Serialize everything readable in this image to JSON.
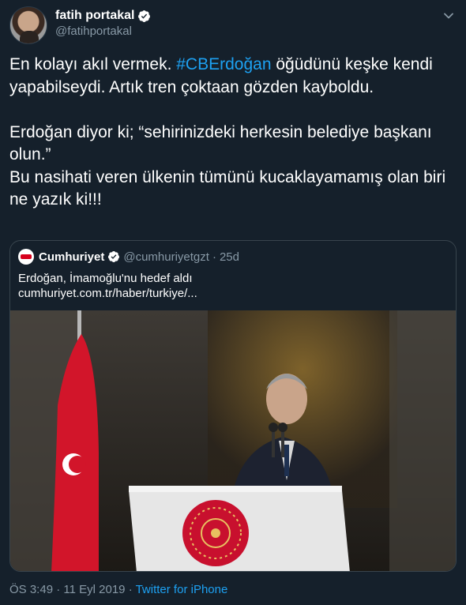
{
  "author": {
    "display_name": "fatih portakal",
    "handle": "@fatihportakal"
  },
  "tweet": {
    "text_before": "En kolayı akıl vermek. ",
    "hashtag": "#CBErdoğan",
    "text_after": " öğüdünü keşke kendi yapabilseydi. Artık tren çoktaan gözden kayboldu.\n\nErdoğan diyor ki; “sehirinizdeki herkesin belediye başkanı olun.”\nBu nasihati veren ülkenin tümünü kucaklayamamış olan biri ne yazık ki!!!"
  },
  "quote": {
    "name": "Cumhuriyet",
    "handle": "@cumhuriyetgzt",
    "separator": "·",
    "time": "25d",
    "title": "Erdoğan, İmamoğlu'nu hedef aldı",
    "link": "cumhuriyet.com.tr/haber/turkiye/..."
  },
  "footer": {
    "time": "ÖS 3:49",
    "separator": "·",
    "date": "11 Eyl 2019",
    "source": "Twitter for iPhone"
  },
  "colors": {
    "background": "#15202b",
    "accent": "#1da1f2",
    "secondary_text": "#8899a6",
    "border": "#38444d"
  },
  "icons": [
    "verified-badge-icon",
    "chevron-down-icon"
  ]
}
